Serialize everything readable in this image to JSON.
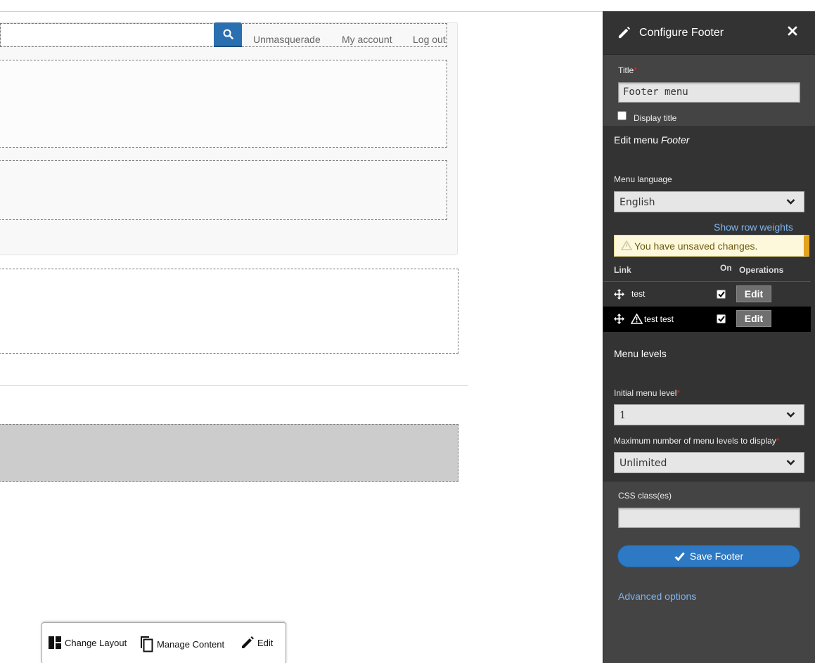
{
  "page": {
    "user_menu": [
      "Unmasquerade",
      "My account",
      "Log out"
    ]
  },
  "toolbar": {
    "change_layout": "Change Layout",
    "manage_content": "Manage Content",
    "edit": "Edit"
  },
  "panel": {
    "title": "Configure Footer",
    "title_label": "Title",
    "title_value": "Footer menu",
    "display_title_label": "Display title",
    "edit_menu_prefix": "Edit menu ",
    "edit_menu_name": "Footer",
    "menu_language_label": "Menu language",
    "menu_language_value": "English",
    "show_row_weights": "Show row weights",
    "unsaved_warning": "You have unsaved changes.",
    "table_headers": {
      "link": "Link",
      "on": "On",
      "operations": "Operations"
    },
    "rows": [
      {
        "title": "test",
        "enabled": true,
        "op": "Edit"
      },
      {
        "title": "test test",
        "enabled": true,
        "op": "Edit",
        "changed": true
      }
    ],
    "menu_levels_heading": "Menu levels",
    "initial_level_label": "Initial menu level",
    "initial_level_value": "1",
    "max_levels_label": "Maximum number of menu levels to display",
    "max_levels_value": "Unlimited",
    "css_label": "CSS class(es)",
    "css_value": "",
    "save_button": "Save Footer",
    "advanced_options": "Advanced options"
  },
  "colors": {
    "panel_bg": "#444444",
    "primary": "#2e79c3",
    "link": "#7cb4ef",
    "warning_bg": "#fdf8db",
    "required": "#e02020"
  }
}
